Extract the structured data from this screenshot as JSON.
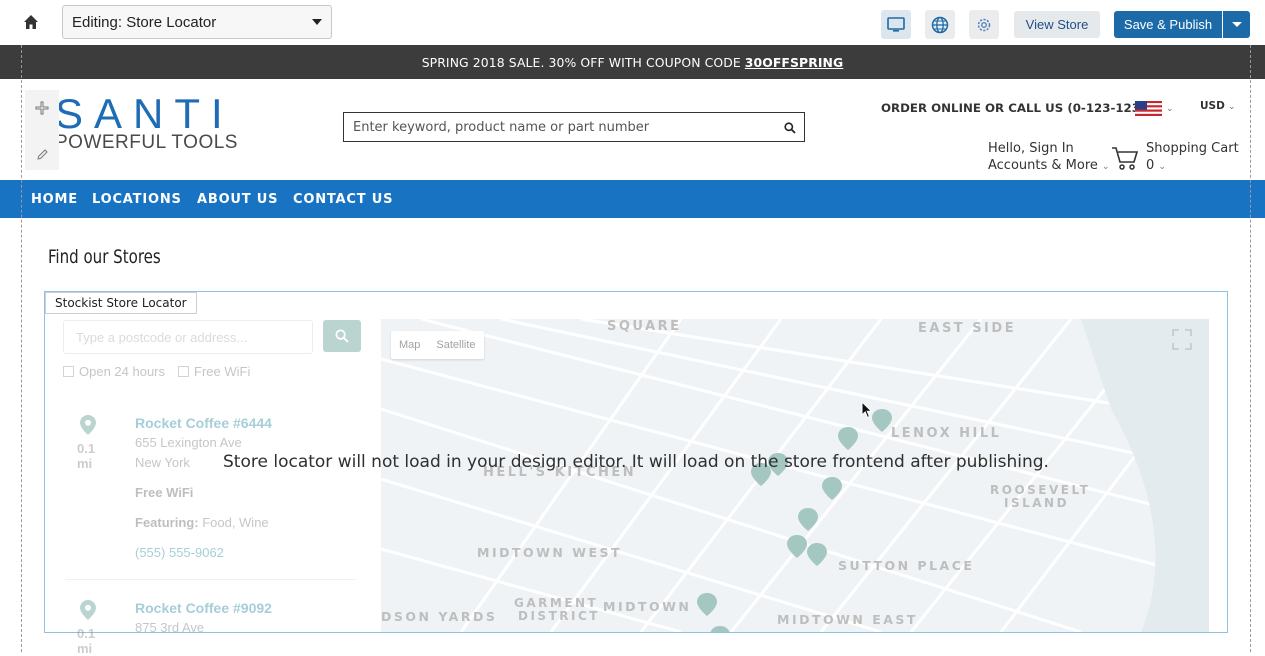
{
  "editor": {
    "page_select_value": "Editing: Store Locator",
    "view_store_label": "View Store",
    "publish_label": "Save & Publish",
    "icons": [
      "home-icon",
      "desktop-icon",
      "globe-icon",
      "gear-icon",
      "chevron-down-icon"
    ]
  },
  "promo": {
    "text": "SPRING 2018 SALE. 30% OFF WITH COUPON CODE",
    "code": "30OFFSPRING"
  },
  "header": {
    "logo_main": "SANTI",
    "logo_sub": "POWERFUL TOOLS",
    "search_placeholder": "Enter keyword, product name or part number",
    "order_text": "ORDER ONLINE OR CALL US (0-123-1234)",
    "currency": "USD",
    "account_line1": "Hello, Sign In",
    "account_line2": "Accounts & More",
    "cart_label": "Shopping Cart",
    "cart_count": "0"
  },
  "nav": {
    "items": [
      "HOME",
      "LOCATIONS",
      "ABOUT US",
      "CONTACT US"
    ]
  },
  "main": {
    "title": "Find our Stores",
    "widget_label": "Stockist Store Locator",
    "notice": "Store locator will not load in your design editor. It will load on the store frontend after publishing."
  },
  "locator": {
    "address_placeholder": "Type a postcode or address...",
    "filters": [
      "Open 24 hours",
      "Free WiFi"
    ],
    "stores": [
      {
        "name": "Rocket Coffee #6444",
        "distance": "0.1 mi",
        "address": "655 Lexington Ave",
        "city": "New York",
        "amenity": "Free WiFi",
        "featuring_label": "Featuring:",
        "featuring": "Food, Wine",
        "phone": "(555) 555-9062"
      },
      {
        "name": "Rocket Coffee #9092",
        "distance": "0.1 mi",
        "address": "875 3rd Ave"
      }
    ]
  },
  "map": {
    "toggle": [
      "Map",
      "Satellite"
    ],
    "labels": [
      "SQUARE",
      "EAST SIDE",
      "LENOX HILL",
      "HELL'S KITCHEN",
      "ROOSEVELT",
      "ISLAND",
      "MIDTOWN WEST",
      "SUTTON PLACE",
      "GARMENT",
      "DISTRICT",
      "MIDTOWN",
      "DSON YARDS",
      "MIDTOWN EAST"
    ],
    "accent_color": "#5c9a8f"
  },
  "colors": {
    "brand_blue": "#1874c3",
    "promo_bg": "#3c3c3c",
    "publish_bg": "#1d6aa9"
  }
}
